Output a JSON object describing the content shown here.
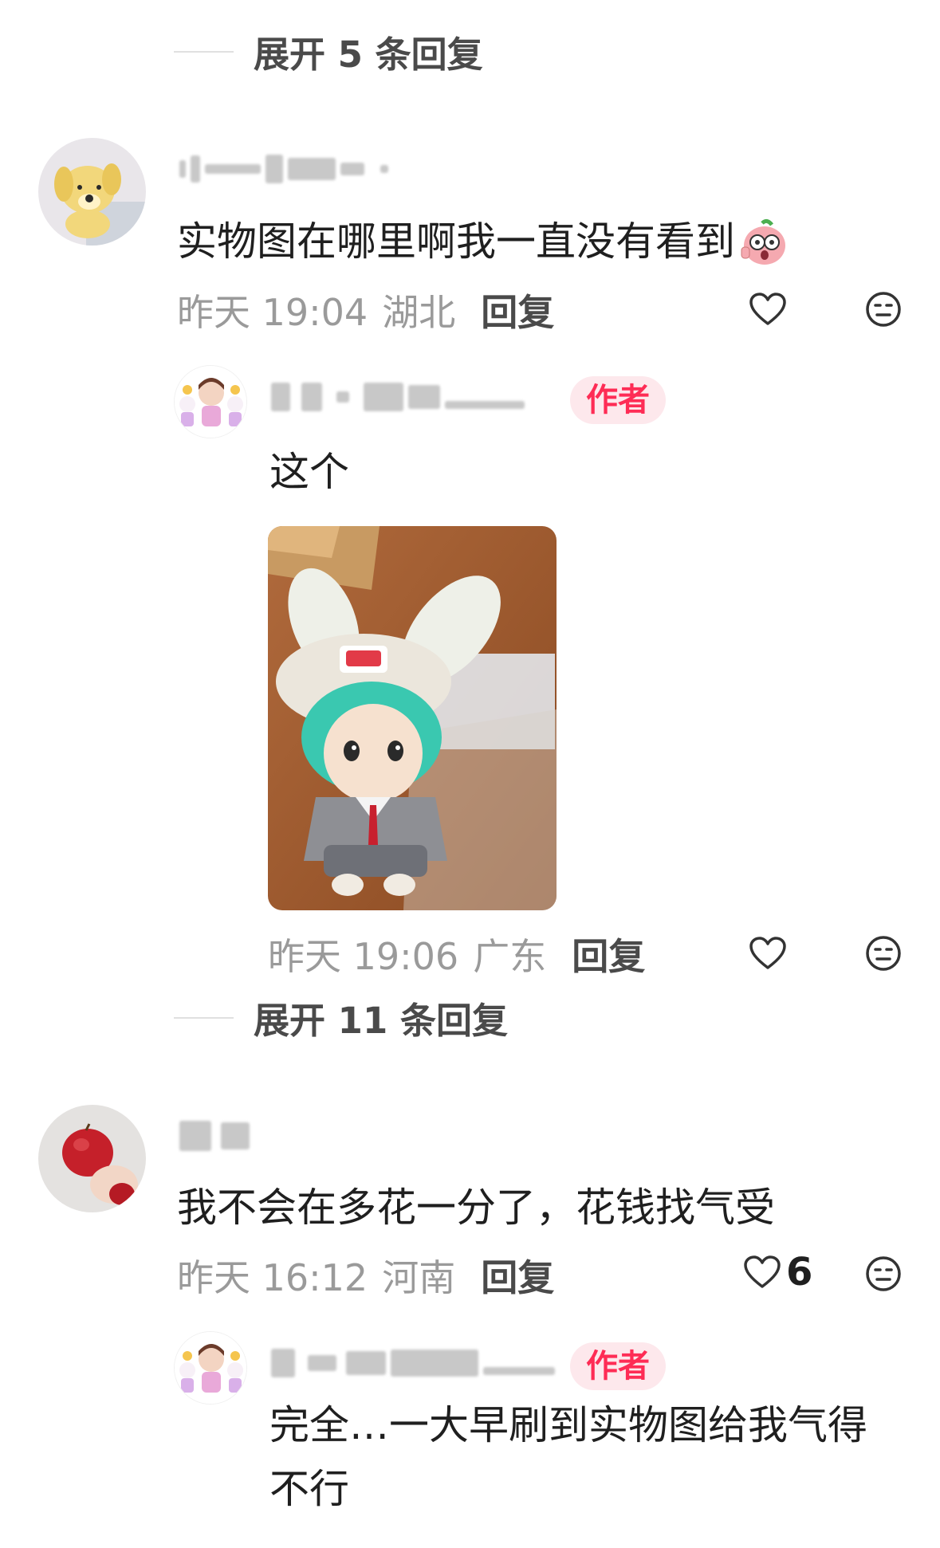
{
  "thread1": {
    "expand_label": "展开 5 条回复"
  },
  "comment1": {
    "text": "实物图在哪里啊我一直没有看到",
    "time": "昨天 19:04",
    "location": "湖北",
    "reply_label": "回复",
    "emoji_icon": "surprised-cartoon-emoji-icon"
  },
  "reply1": {
    "badge": "作者",
    "text": "这个",
    "time": "昨天 19:06",
    "location": "广东",
    "reply_label": "回复"
  },
  "thread2": {
    "expand_label": "展开 11 条回复"
  },
  "comment2": {
    "text": "我不会在多花一分了，花钱找气受",
    "time": "昨天 16:12",
    "location": "河南",
    "reply_label": "回复",
    "like_count": "6"
  },
  "reply2": {
    "badge": "作者",
    "text_line1": "完全…一大早刷到实物图给我气得",
    "text_line2": "不行"
  },
  "colors": {
    "accent": "#fe2c55",
    "badge_bg": "#fde8ec",
    "meta_gray": "#9a9a9a"
  }
}
